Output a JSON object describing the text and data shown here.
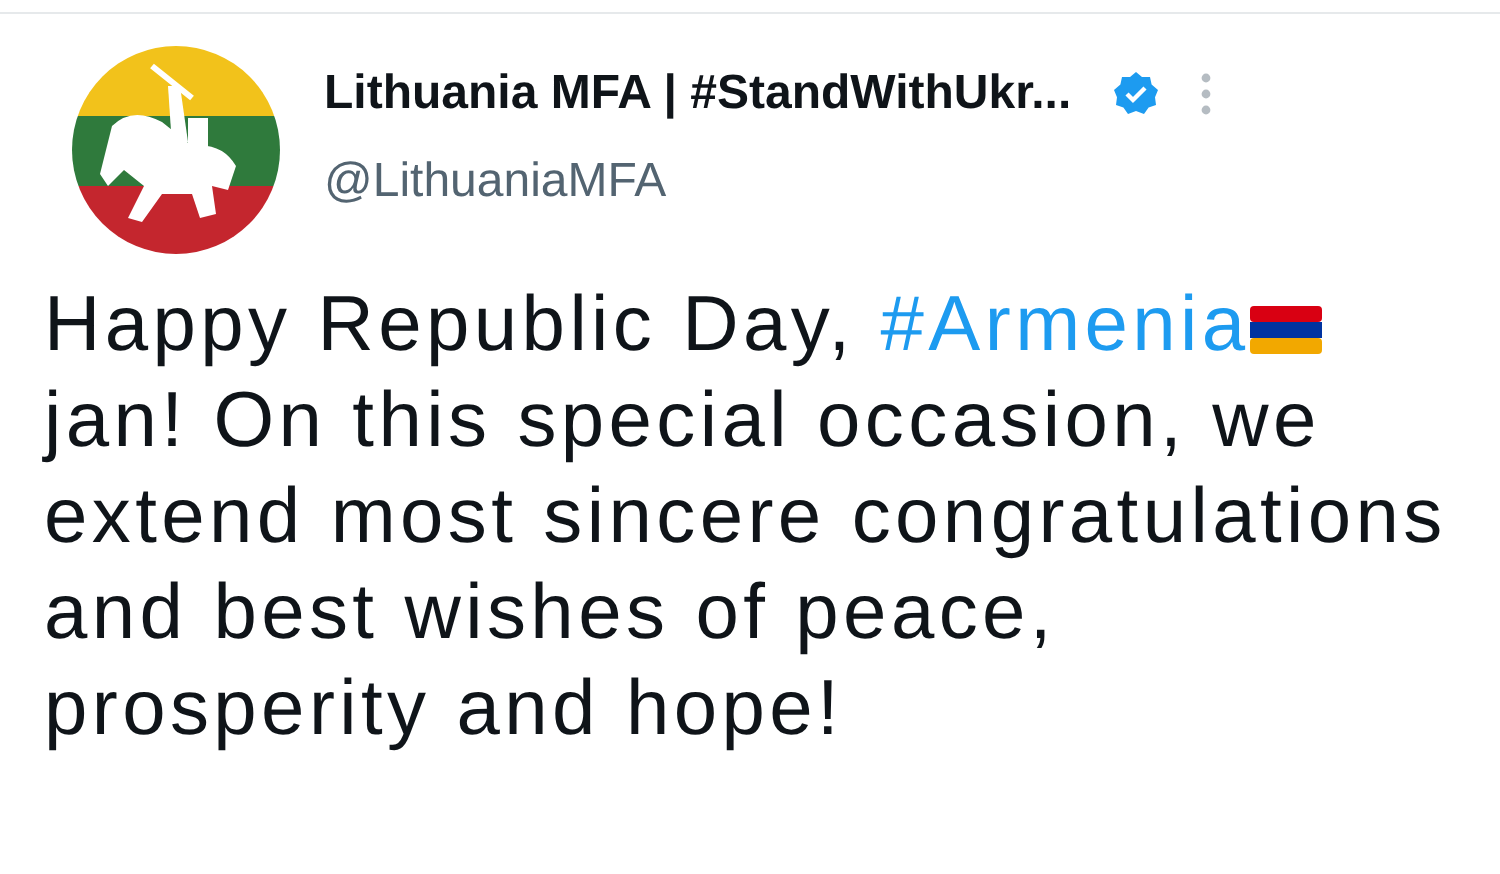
{
  "author": {
    "name": "Lithuania MFA | #StandWithUkr...",
    "verified": true,
    "handle": "@LithuaniaMFA"
  },
  "body": [
    {
      "kind": "text",
      "text": "Happy Republic Day, "
    },
    {
      "kind": "hashtag",
      "text": "#Armenia"
    },
    {
      "kind": "flag"
    },
    {
      "kind": "text",
      "text": " jan! On this special occasion, we extend most sincere congratulations and best wishes of peace, prosperity and hope!"
    }
  ]
}
